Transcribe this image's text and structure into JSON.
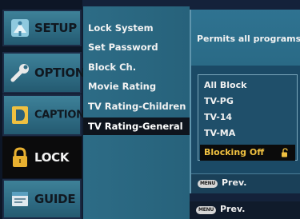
{
  "tabs": [
    {
      "label": "SETUP",
      "icon": "satellite-dish-icon",
      "active": false
    },
    {
      "label": "OPTION",
      "icon": "wrench-icon",
      "active": false
    },
    {
      "label": "CAPTION",
      "icon": "caption-icon",
      "active": false
    },
    {
      "label": "LOCK",
      "icon": "padlock-icon",
      "active": true
    },
    {
      "label": "GUIDE",
      "icon": "guide-book-icon",
      "active": false
    }
  ],
  "menu": {
    "items": [
      {
        "label": "Lock System"
      },
      {
        "label": "Set Password"
      },
      {
        "label": "Block Ch."
      },
      {
        "label": "Movie Rating"
      },
      {
        "label": "TV Rating-Children"
      },
      {
        "label": "TV Rating-General"
      }
    ],
    "selected_index": 5
  },
  "submenu": {
    "description": "Permits all programs",
    "options": [
      {
        "label": "All Block"
      },
      {
        "label": "TV-PG"
      },
      {
        "label": "TV-14"
      },
      {
        "label": "TV-MA"
      },
      {
        "label": "Blocking Off"
      }
    ],
    "selected_index": 4,
    "selected_icon": "unlocked-padlock-icon"
  },
  "footer": {
    "menu_key_label": "MENU",
    "prev_label": "Prev."
  },
  "colors": {
    "accent_selected_text": "#f0c040",
    "tab_blue": "#2f6c84",
    "menu_blue": "#2d6c86"
  }
}
